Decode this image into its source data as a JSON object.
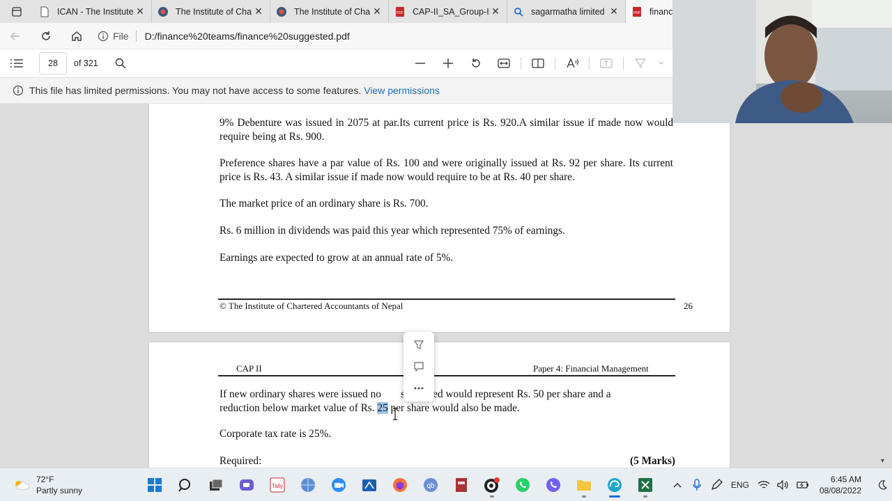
{
  "tabs": [
    {
      "title": "ICAN - The Institute",
      "icon": "document-icon"
    },
    {
      "title": "The Institute of Cha",
      "icon": "ican-logo-icon"
    },
    {
      "title": "The Institute of Cha",
      "icon": "ican-logo-icon"
    },
    {
      "title": "CAP-II_SA_Group-II",
      "icon": "pdf-icon"
    },
    {
      "title": "sagarmatha limited",
      "icon": "search-icon"
    },
    {
      "title": "financ",
      "icon": "pdf-icon"
    }
  ],
  "address": {
    "file_label": "File",
    "url": "D:/finance%20teams/finance%20suggested.pdf"
  },
  "pdf_toolbar": {
    "page_number": "28",
    "of_pages": "of 321"
  },
  "infobar": {
    "message": "This file has limited permissions. You may not have access to some features.",
    "link": "View permissions"
  },
  "page1": {
    "para1": "9% Debenture was issued in 2075 at par.Its current price is Rs. 920.A similar issue if made now would require being at Rs. 900.",
    "para2": "Preference shares have a par value of Rs. 100 and were originally issued at Rs. 92 per share. Its current price is Rs. 43. A similar issue if made now would require to be at Rs. 40 per share.",
    "para3": "The market price of an ordinary share is Rs. 700.",
    "para4": "Rs. 6 million in dividends was paid this year which represented 75% of earnings.",
    "para5": "Earnings are expected to grow at an annual rate of 5%.",
    "footer_left": "© The Institute of Chartered Accountants of Nepal",
    "footer_right": "26"
  },
  "page2": {
    "header_left": "CAP II",
    "header_right": "Paper 4: Financial Management",
    "para1_a": "If new ordinary shares were issued no",
    "para1_b": "s incurred would represent Rs. 50 per share and a",
    "para1_c": "reduction below market value of Rs. ",
    "para1_selected": "25",
    "para1_d": " per share would also be made.",
    "para2": "Corporate tax rate is 25%.",
    "required": "Required:",
    "marks": "(5 Marks)"
  },
  "taskbar": {
    "weather_temp": "72°F",
    "weather_desc": "Partly sunny",
    "lang": "ENG",
    "time": "6:45 AM",
    "date": "08/08/2022"
  }
}
